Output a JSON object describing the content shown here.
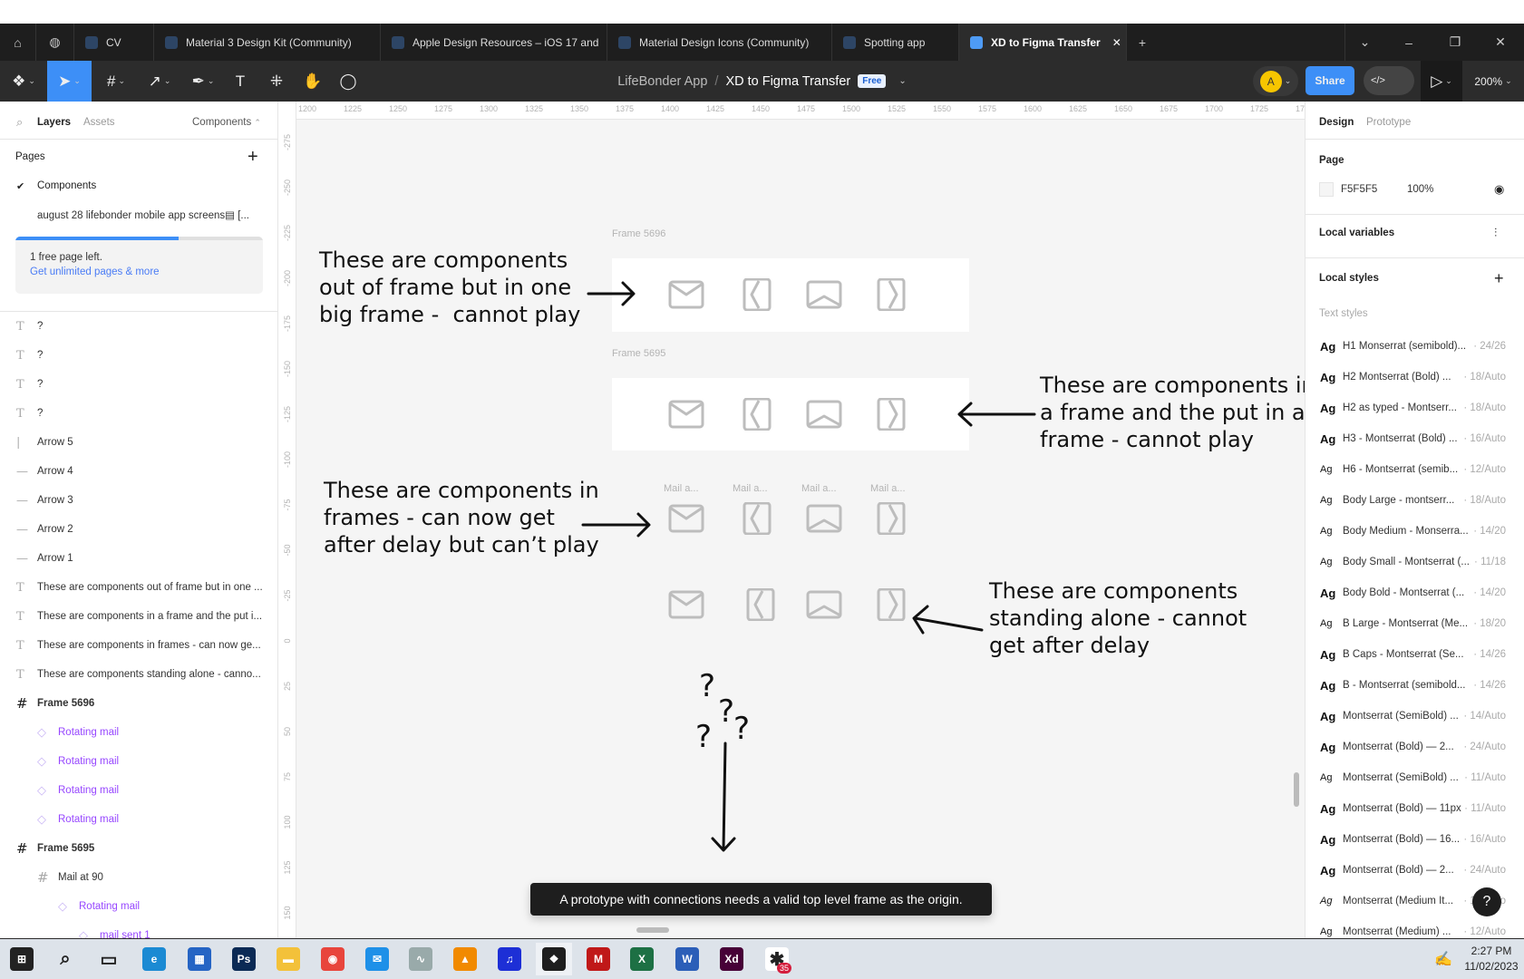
{
  "browser_tabs": [
    {
      "label": "CV"
    },
    {
      "label": "Material 3 Design Kit (Community)"
    },
    {
      "label": "Apple Design Resources – iOS 17 and"
    },
    {
      "label": "Material Design Icons (Community)"
    },
    {
      "label": "Spotting app"
    },
    {
      "label": "XD to Figma Transfer",
      "active": true
    }
  ],
  "window": {
    "new_tab": "+",
    "dropdown": "⌄",
    "minimize": "–",
    "restore": "❐",
    "close": "✕",
    "tab_close": "✕"
  },
  "toolbar": {
    "project": "LifeBonder App",
    "separator": "/",
    "file": "XD to Figma Transfer",
    "plan_badge": "Free",
    "avatar_initial": "A",
    "share": "Share",
    "zoom": "200%",
    "accent": "#3d8ff7"
  },
  "left_panel": {
    "tabs": {
      "layers": "Layers",
      "assets": "Assets",
      "components": "Components"
    },
    "pages_title": "Pages",
    "pages": [
      {
        "label": "Components",
        "current": true
      },
      {
        "label": "august 28 lifebonder mobile app screens▤ [..."
      }
    ],
    "upsell": {
      "text": "1 free page left.",
      "link": "Get unlimited pages & more",
      "progress": 0.66
    },
    "layers": [
      {
        "icon": "text",
        "label": "?",
        "indent": 0
      },
      {
        "icon": "text",
        "label": "?",
        "indent": 0
      },
      {
        "icon": "text",
        "label": "?",
        "indent": 0
      },
      {
        "icon": "text",
        "label": "?",
        "indent": 0
      },
      {
        "icon": "arrow",
        "label": "Arrow 5",
        "indent": 0
      },
      {
        "icon": "arrow",
        "label": "Arrow 4",
        "indent": 0
      },
      {
        "icon": "arrow",
        "label": "Arrow 3",
        "indent": 0
      },
      {
        "icon": "arrow",
        "label": "Arrow 2",
        "indent": 0
      },
      {
        "icon": "arrow",
        "label": "Arrow 1",
        "indent": 0
      },
      {
        "icon": "text",
        "label": "These are components out of frame but in one ...",
        "indent": 0
      },
      {
        "icon": "text",
        "label": "These are components in a frame and the put i...",
        "indent": 0
      },
      {
        "icon": "text",
        "label": "These are components in frames - can now ge...",
        "indent": 0
      },
      {
        "icon": "text",
        "label": "These are components standing alone - canno...",
        "indent": 0
      },
      {
        "icon": "frame",
        "label": "Frame 5696",
        "indent": 0,
        "bold": true
      },
      {
        "icon": "component",
        "label": "Rotating mail",
        "indent": 1
      },
      {
        "icon": "component",
        "label": "Rotating mail",
        "indent": 1
      },
      {
        "icon": "component",
        "label": "Rotating mail",
        "indent": 1
      },
      {
        "icon": "component",
        "label": "Rotating mail",
        "indent": 1
      },
      {
        "icon": "frame",
        "label": "Frame 5695",
        "indent": 0,
        "bold": true
      },
      {
        "icon": "frame-light",
        "label": "Mail at 90",
        "indent": 1
      },
      {
        "icon": "component",
        "label": "Rotating mail",
        "indent": 2
      },
      {
        "icon": "component",
        "label": "mail sent 1",
        "indent": 3
      }
    ]
  },
  "right_panel": {
    "tabs": {
      "design": "Design",
      "prototype": "Prototype"
    },
    "page": {
      "title": "Page",
      "color": "F5F5F5",
      "opacity": "100%"
    },
    "local_variables": "Local variables",
    "local_styles": "Local styles",
    "text_styles_title": "Text styles",
    "text_styles": [
      {
        "name": "H1 Monserrat (semibold)...",
        "spec": "· 24/26",
        "weight": "bold"
      },
      {
        "name": "H2 Montserrat (Bold) ...",
        "spec": "· 18/Auto",
        "weight": "bold"
      },
      {
        "name": "H2 as typed - Montserr...",
        "spec": "· 18/Auto",
        "weight": "bold"
      },
      {
        "name": "H3 - Montserrat (Bold) ...",
        "spec": "· 16/Auto",
        "weight": "bold"
      },
      {
        "name": "H6 - Montserrat (semib...",
        "spec": "· 12/Auto",
        "weight": "normal"
      },
      {
        "name": "Body Large - montserr...",
        "spec": "· 18/Auto",
        "weight": "normal"
      },
      {
        "name": "Body Medium - Monserra...",
        "spec": "· 14/20",
        "weight": "normal"
      },
      {
        "name": "Body Small - Montserrat (...",
        "spec": "· 11/18",
        "weight": "normal"
      },
      {
        "name": "Body Bold - Montserrat (...",
        "spec": "· 14/20",
        "weight": "bold"
      },
      {
        "name": "B Large - Montserrat (Me...",
        "spec": "· 18/20",
        "weight": "normal"
      },
      {
        "name": "B Caps - Montserrat (Se...",
        "spec": "· 14/26",
        "weight": "bold"
      },
      {
        "name": "B - Montserrat (semibold...",
        "spec": "· 14/26",
        "weight": "bold"
      },
      {
        "name": "Montserrat (SemiBold) ...",
        "spec": "· 14/Auto",
        "weight": "bold"
      },
      {
        "name": "Montserrat (Bold) — 2...",
        "spec": "· 24/Auto",
        "weight": "bold"
      },
      {
        "name": "Montserrat (SemiBold) ...",
        "spec": "· 11/Auto",
        "weight": "normal"
      },
      {
        "name": "Montserrat (Bold) — 11px",
        "spec": "· 11/Auto",
        "weight": "bold"
      },
      {
        "name": "Montserrat (Bold) — 16...",
        "spec": "· 16/Auto",
        "weight": "bold"
      },
      {
        "name": "Montserrat (Bold) — 2...",
        "spec": "· 24/Auto",
        "weight": "bold"
      },
      {
        "name": "Montserrat (Medium It...",
        "spec": "· 14/Auto",
        "weight": "italic"
      },
      {
        "name": "Montserrat (Medium) ...",
        "spec": "· 12/Auto",
        "weight": "normal"
      }
    ],
    "style_sample": "Ag",
    "help": "?"
  },
  "canvas": {
    "ruler_h": [
      "1200",
      "1225",
      "1250",
      "1275",
      "1300",
      "1325",
      "1350",
      "1375",
      "1400",
      "1425",
      "1450",
      "1475",
      "1500",
      "1525",
      "1550",
      "1575",
      "1600",
      "1625",
      "1650",
      "1675",
      "1700",
      "1725",
      "17"
    ],
    "ruler_v": [
      "-275",
      "-250",
      "-225",
      "-200",
      "-175",
      "-150",
      "-125",
      "-100",
      "-75",
      "-50",
      "-25",
      "0",
      "25",
      "50",
      "75",
      "100",
      "125",
      "150"
    ],
    "frame_5696": "Frame 5696",
    "frame_5695": "Frame 5695",
    "mail_labels": [
      "Mail a...",
      "Mail a...",
      "Mail a...",
      "Mail a..."
    ],
    "notes": [
      "These are components\nout of frame but in one\nbig frame -  cannot play",
      "These are components in\na frame and the put in a\nframe - cannot play",
      "These are components in\nframes - can now get\nafter delay but can’t play",
      "These are components\nstanding alone - cannot\nget after delay"
    ],
    "question_marks": [
      "?",
      "?",
      "?",
      "?"
    ],
    "toast": "A prototype with connections needs a valid top level frame as the origin."
  },
  "taskbar": {
    "apps": [
      "start",
      "search",
      "task-view",
      "edge",
      "store",
      "photoshop",
      "file-explorer",
      "chrome",
      "mail",
      "monitor",
      "vlc",
      "audacity",
      "figma",
      "mcafee",
      "excel",
      "word",
      "xd",
      "slack"
    ],
    "slack_badge": "35",
    "time": "2:27 PM",
    "date": "11/02/2023"
  }
}
